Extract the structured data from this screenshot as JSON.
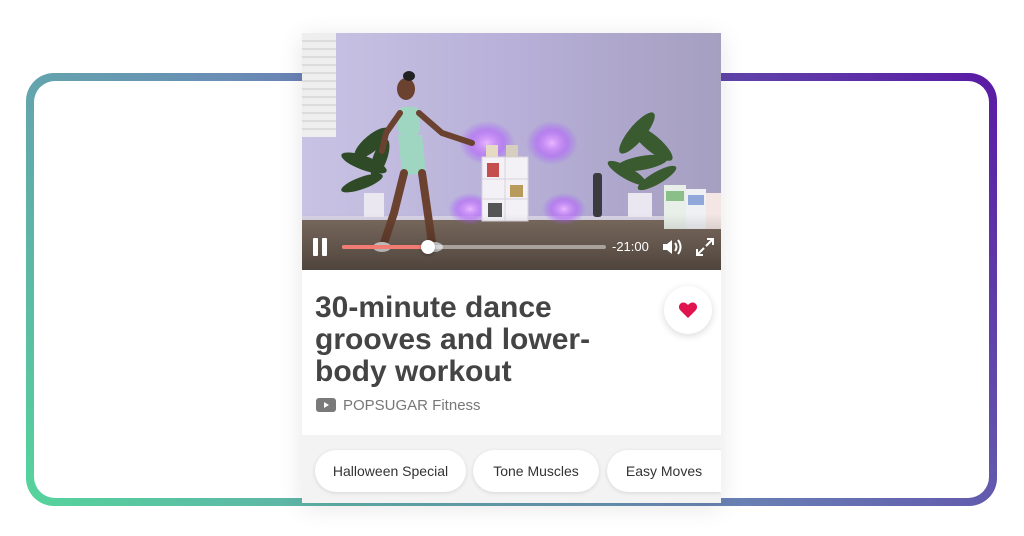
{
  "video": {
    "time_remaining": "-21:00",
    "progress": 0.325,
    "accent_color": "#f07c73",
    "controls": {
      "pause_icon": "pause-icon",
      "volume_icon": "volume-icon",
      "fullscreen_icon": "fullscreen-icon"
    }
  },
  "info": {
    "title": "30-minute dance grooves and lower-body workout",
    "source": "POPSUGAR Fitness",
    "source_icon": "youtube-icon",
    "favorite_icon": "heart-icon",
    "favorite_color": "#e0144f"
  },
  "tags": [
    {
      "label": "Halloween Special"
    },
    {
      "label": "Tone Muscles"
    },
    {
      "label": "Easy Moves"
    }
  ],
  "frame": {
    "gradient_start": "#55d49c",
    "gradient_end": "#5a1aa4"
  }
}
